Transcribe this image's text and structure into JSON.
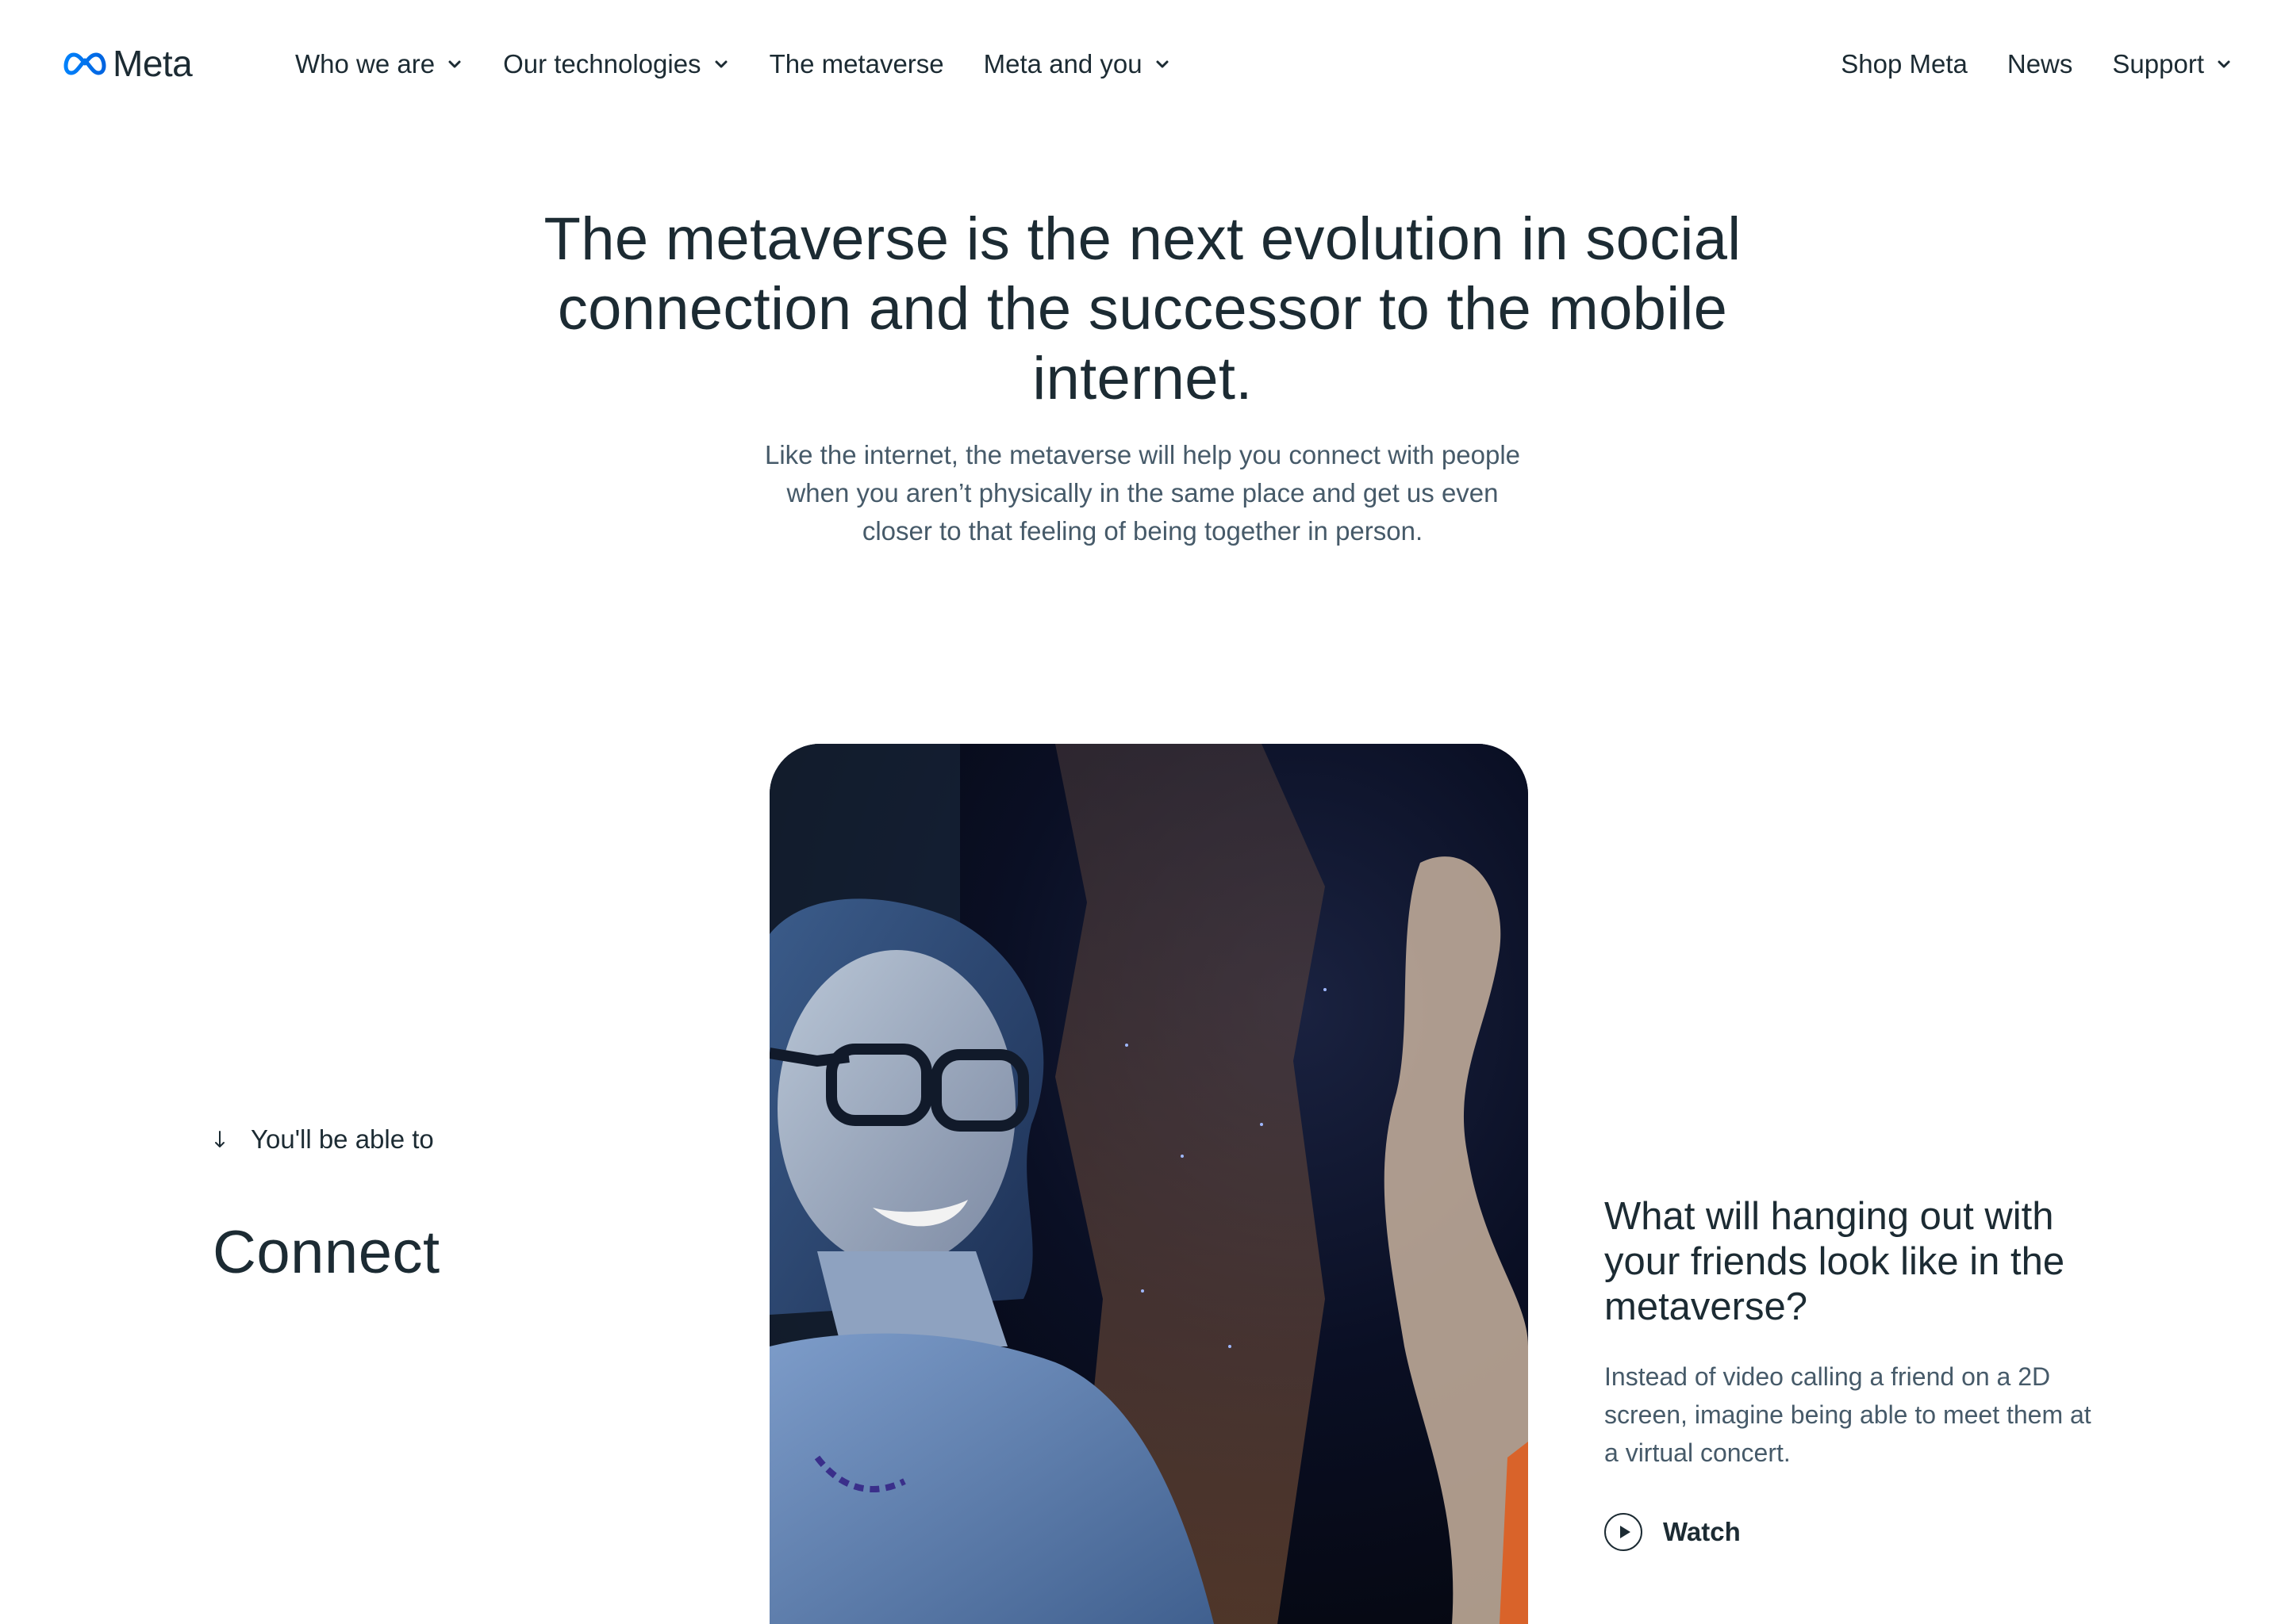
{
  "header": {
    "logo_text": "Meta",
    "nav_left": [
      {
        "label": "Who we are",
        "has_dropdown": true
      },
      {
        "label": "Our technologies",
        "has_dropdown": true
      },
      {
        "label": "The metaverse",
        "has_dropdown": false
      },
      {
        "label": "Meta and you",
        "has_dropdown": true
      }
    ],
    "nav_right": [
      {
        "label": "Shop Meta",
        "has_dropdown": false
      },
      {
        "label": "News",
        "has_dropdown": false
      },
      {
        "label": "Support",
        "has_dropdown": true
      }
    ]
  },
  "hero": {
    "title": "The metaverse is the next evolution in social connection and the successor to the mobile internet.",
    "subtitle": "Like the internet, the metaverse will help you connect with people when you aren’t physically in the same place and get us even closer to that feeling of being together in person."
  },
  "section": {
    "eyebrow": "You'll be able to",
    "title": "Connect",
    "media": {
      "icon": "video-still-image"
    },
    "info": {
      "heading": "What will hanging out with your friends look like in the metaverse?",
      "text": "Instead of video calling a friend on a 2D screen, imagine being able to meet them at a virtual concert.",
      "watch_label": "Watch"
    }
  },
  "colors": {
    "text_primary": "#1c2b33",
    "text_secondary": "#465a69",
    "brand_blue": "#0668e1",
    "background": "#ffffff"
  }
}
